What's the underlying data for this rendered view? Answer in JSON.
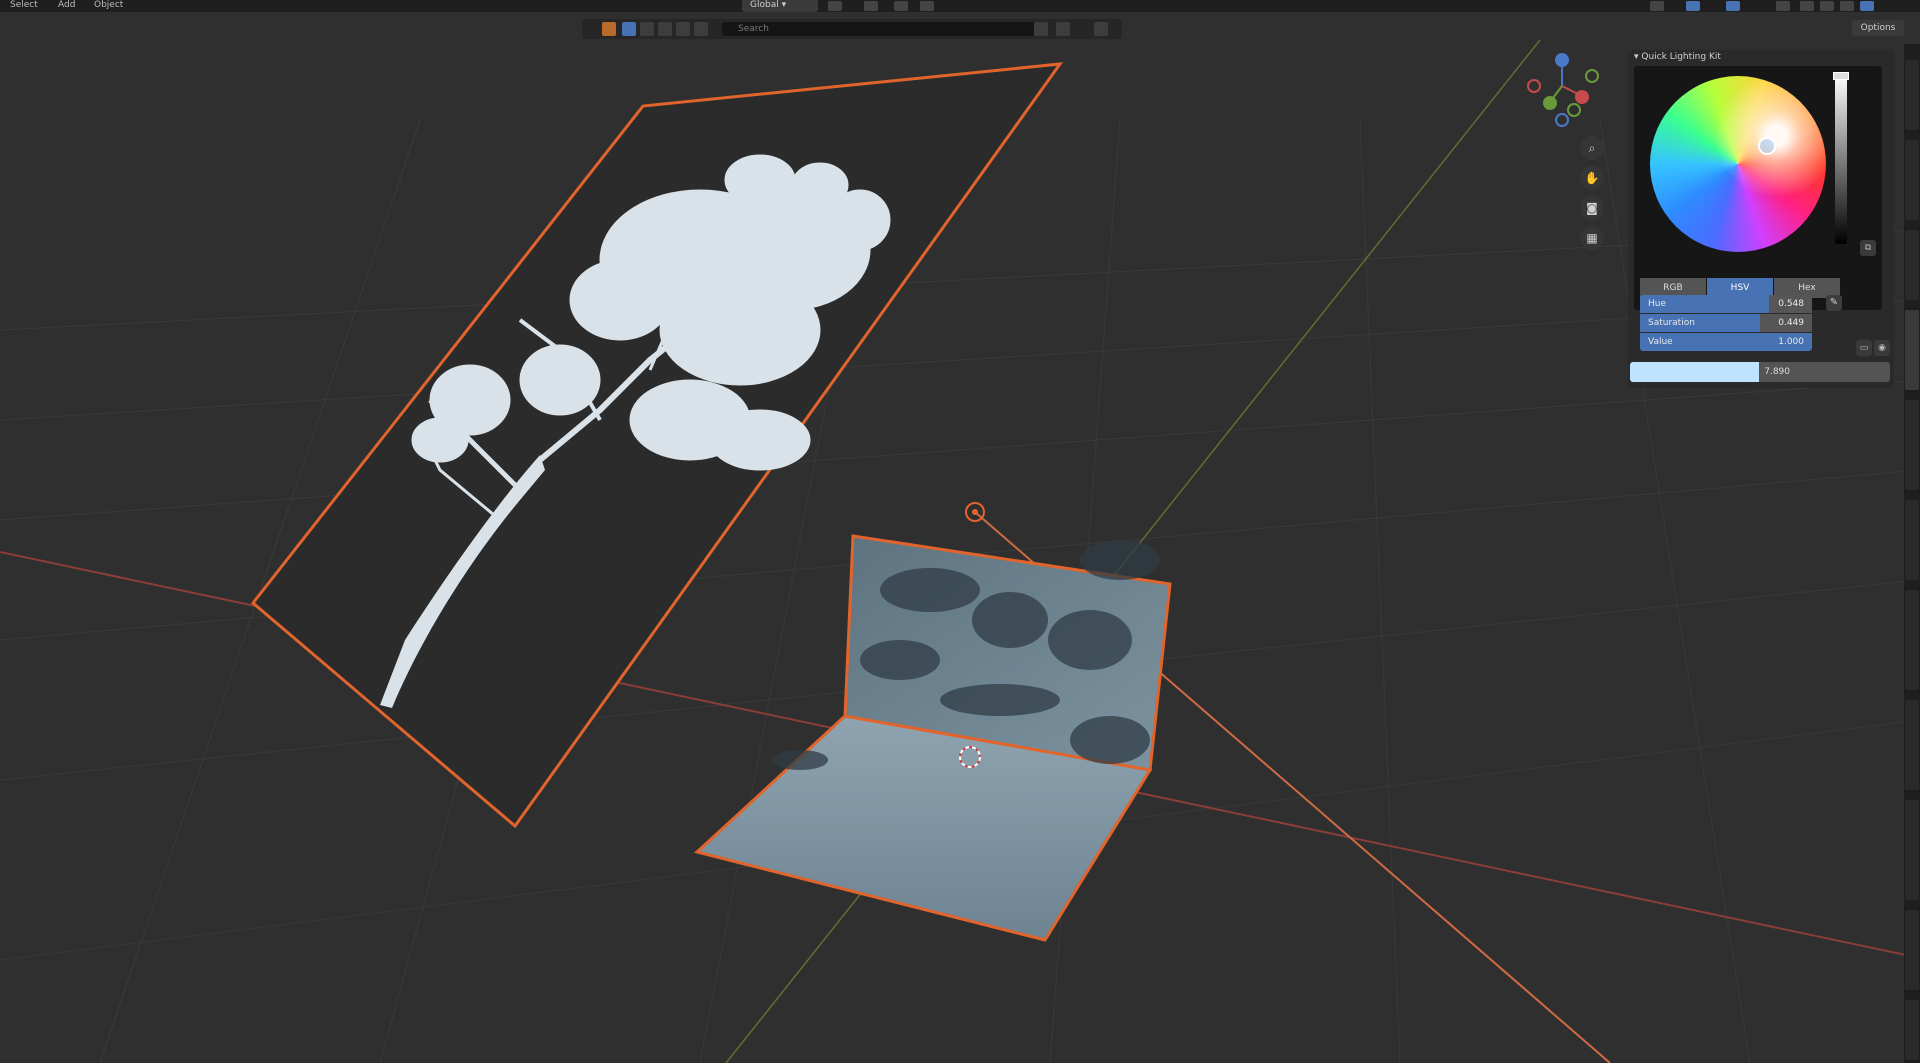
{
  "menu": {
    "select": "Select",
    "add": "Add",
    "object": "Object"
  },
  "header": {
    "orientation": "Global",
    "options": "Options",
    "search_placeholder": "Search"
  },
  "panel": {
    "title": "Quick Lighting Kit",
    "color_modes": [
      "RGB",
      "HSV",
      "Hex"
    ],
    "active_mode": "HSV",
    "hue_label": "Hue",
    "hue_value": "0.548",
    "hue_fraction": 0.548,
    "saturation_label": "Saturation",
    "saturation_value": "0.449",
    "saturation_fraction": 0.449,
    "value_label": "Value",
    "value_value": "1.000",
    "value_fraction": 1.0,
    "strength_value": "7.890"
  },
  "colors": {
    "selection_outline": "#e0642c",
    "accent": "#4772b3",
    "x_axis": "#b34a45",
    "y_axis": "#7a8f3a"
  },
  "icons": [
    "zoom-icon",
    "pan-hand-icon",
    "camera-icon",
    "grid-icon",
    "eyedropper-icon",
    "light-icon"
  ]
}
